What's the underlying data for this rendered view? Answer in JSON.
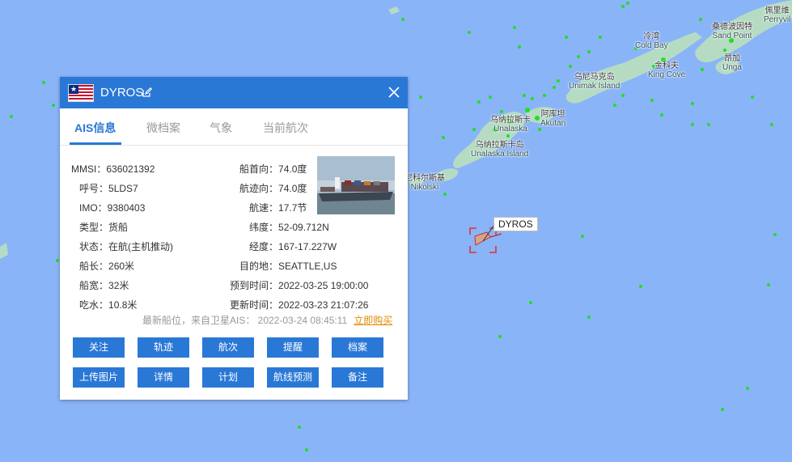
{
  "map": {
    "colors": {
      "sea": "#8ab4f8",
      "land": "#b5dcc3",
      "vessel_dot": "#22dd22",
      "target": "#e03030"
    },
    "places": [
      {
        "zh": "乌尼马克岛",
        "en": "Unimak Island"
      },
      {
        "zh": "冷湾",
        "en": "Cold Bay"
      },
      {
        "zh": "金科夫",
        "en": "King Cove"
      },
      {
        "zh": "桑德波因特",
        "en": "Sand Point"
      },
      {
        "zh": "昂加",
        "en": "Unga"
      },
      {
        "zh": "佩里维",
        "en": "Perryvil"
      },
      {
        "zh": "阿库坦",
        "en": "Akutan"
      },
      {
        "zh": "乌纳拉斯卡",
        "en": "Unalaska"
      },
      {
        "zh": "乌纳拉斯卡岛",
        "en": "Unalaska Island"
      },
      {
        "zh": "尼科尔斯基",
        "en": "Nikolski"
      }
    ],
    "selected_ship_label": "DYROS"
  },
  "panel": {
    "flag_icon": "liberia-flag-icon",
    "ship_name": "DYROS",
    "tabs": [
      {
        "label": "AIS信息",
        "active": true
      },
      {
        "label": "微档案",
        "active": false
      },
      {
        "label": "气象",
        "active": false
      },
      {
        "label": "当前航次",
        "active": false
      }
    ],
    "left_fields": [
      {
        "label": "MMSI：",
        "value": "636021392"
      },
      {
        "label": "呼号：",
        "value": "5LDS7"
      },
      {
        "label": "IMO：",
        "value": "9380403"
      },
      {
        "label": "类型：",
        "value": "货船"
      },
      {
        "label": "状态：",
        "value": "在航(主机推动)"
      },
      {
        "label": "船长：",
        "value": "260米"
      },
      {
        "label": "船宽：",
        "value": "32米"
      },
      {
        "label": "吃水：",
        "value": "10.8米"
      }
    ],
    "right_fields": [
      {
        "label": "船首向：",
        "value": "74.0度"
      },
      {
        "label": "航迹向：",
        "value": "74.0度"
      },
      {
        "label": "航速：",
        "value": "17.7节"
      },
      {
        "label": "纬度：",
        "value": "52-09.712N"
      },
      {
        "label": "经度：",
        "value": "167-17.227W"
      },
      {
        "label": "目的地：",
        "value": "SEATTLE,US"
      },
      {
        "label": "预到时间：",
        "value": "2022-03-25 19:00:00"
      },
      {
        "label": "更新时间：",
        "value": "2022-03-23 21:07:26"
      }
    ],
    "source_text": "最新船位，来自卫星AIS：  2022-03-24 08:45:11",
    "buy_link": "立即购买",
    "buttons_row1": [
      "关注",
      "轨迹",
      "航次",
      "提醒",
      "档案"
    ],
    "buttons_row2": [
      "上传图片",
      "详情",
      "计划",
      "航线预测",
      "备注"
    ]
  }
}
